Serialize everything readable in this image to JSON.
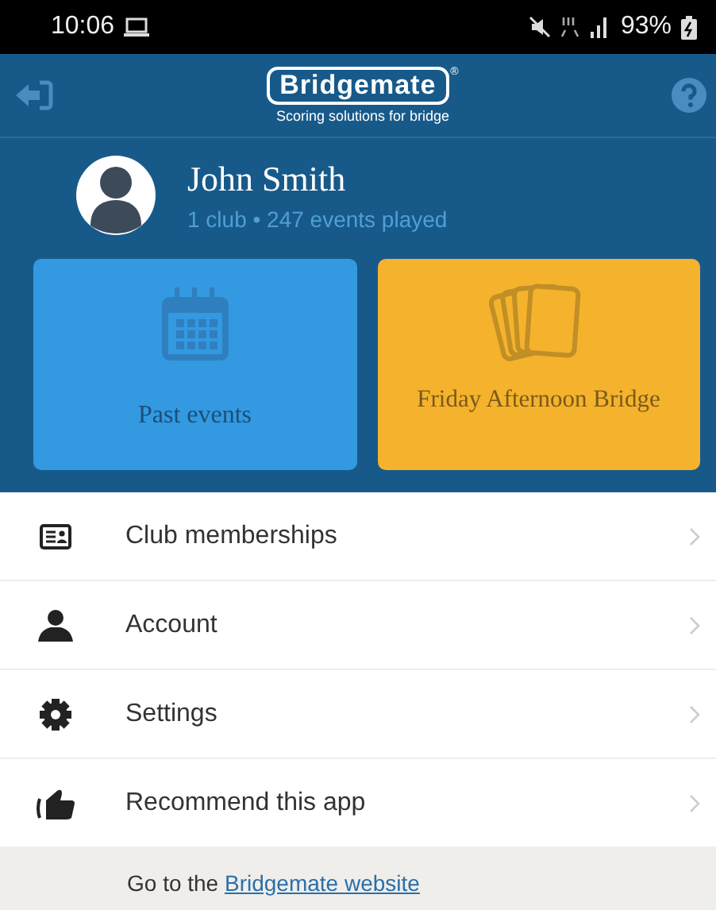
{
  "status_bar": {
    "time": "10:06",
    "battery": "93%"
  },
  "header": {
    "logo": "Bridgemate",
    "registered": "®",
    "tagline": "Scoring solutions for bridge"
  },
  "profile": {
    "name": "John Smith",
    "summary": "1 club • 247 events played"
  },
  "tiles": [
    {
      "label": "Past events",
      "kind": "calendar",
      "color": "#3399e0"
    },
    {
      "label": "Friday Afternoon Bridge",
      "kind": "cards",
      "color": "#f5b22c"
    }
  ],
  "menu": [
    {
      "label": "Club memberships",
      "kind": "card"
    },
    {
      "label": "Account",
      "kind": "person"
    },
    {
      "label": "Settings",
      "kind": "gear"
    },
    {
      "label": "Recommend this app",
      "kind": "thumb"
    }
  ],
  "footer": {
    "text": "Go to the",
    "link": "Bridgemate website"
  }
}
